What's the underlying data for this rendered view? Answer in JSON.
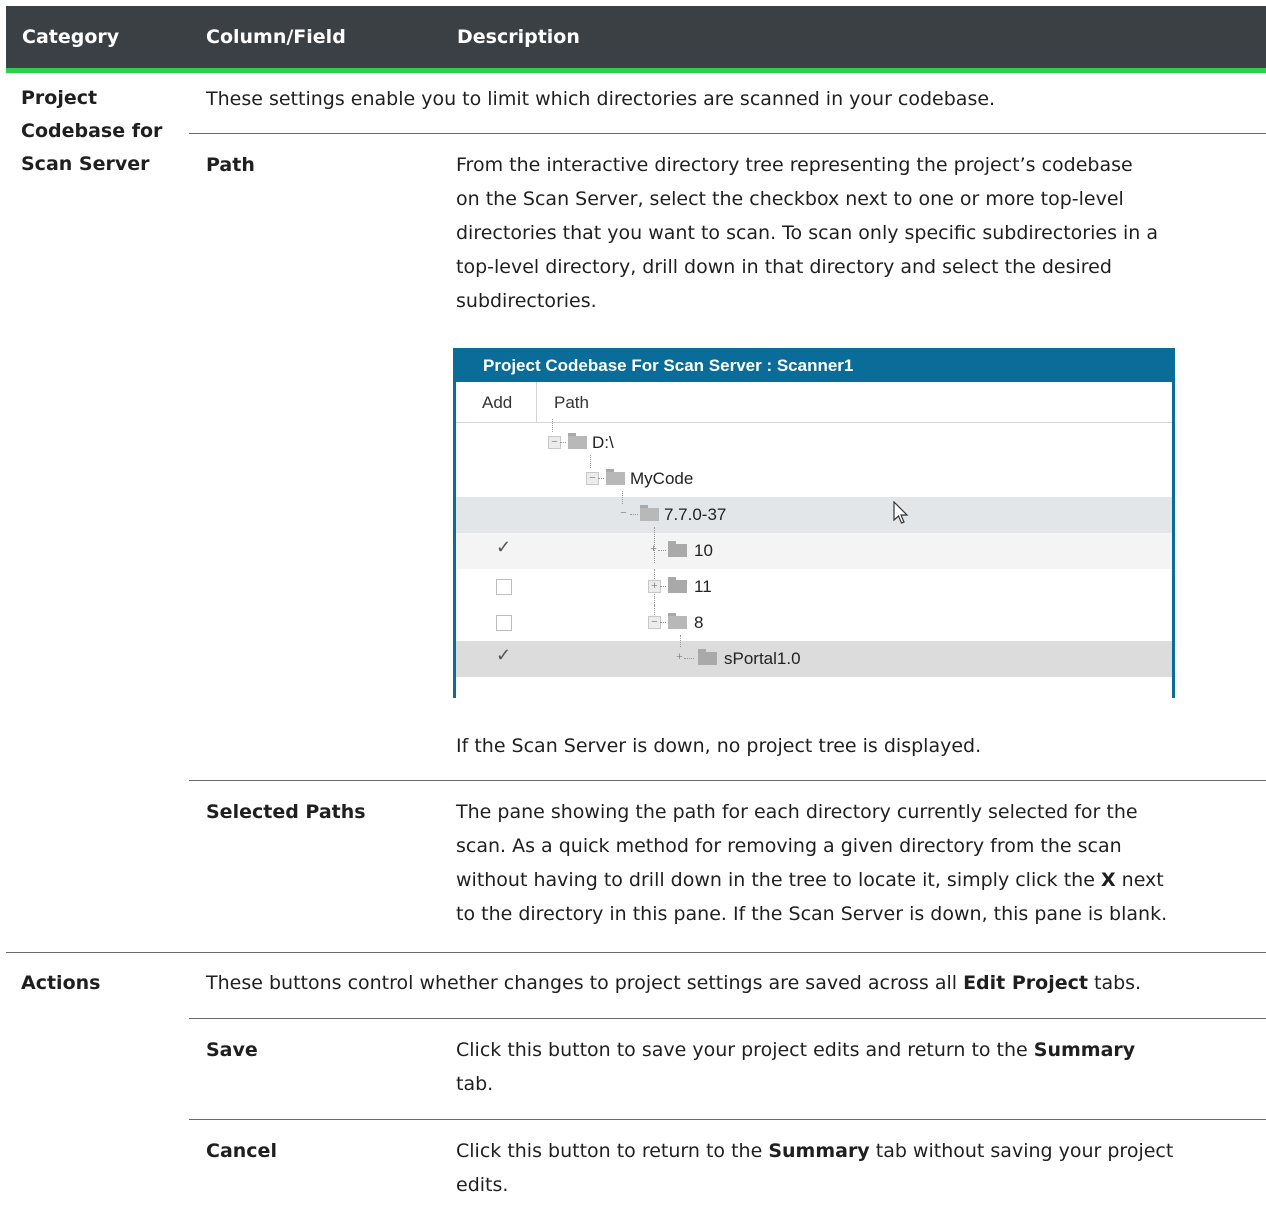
{
  "header": {
    "col1": "Category",
    "col2": "Column/Field",
    "col3": "Description"
  },
  "section1": {
    "category": [
      "Project",
      "Codebase for",
      "Scan Server"
    ],
    "intro": "These settings enable you to limit which directories are scanned in your codebase.",
    "path_field": "Path",
    "path_desc": [
      "From the interactive directory tree representing the project’s codebase",
      "on the Scan Server, select the checkbox next to one or more top-level",
      "directories that you want to scan. To scan only specific subdirectories in a",
      "top-level directory, drill down in that directory and select the desired",
      "subdirectories."
    ],
    "path_note": "If the Scan Server is down, no project tree is displayed.",
    "selected_field": "Selected Paths",
    "selected_desc": [
      "The pane showing the path for each directory currently selected for the",
      "scan. As a quick method for removing a given directory from the scan",
      "without having to drill down in the tree to locate it, simply click the ",
      "X",
      " next",
      "to the directory in this pane. If the Scan Server is down, this pane is blank."
    ]
  },
  "screenshot": {
    "title": "Project Codebase For Scan Server : Scanner1",
    "col_add": "Add",
    "col_path": "Path",
    "rows": [
      {
        "label": "D:\\",
        "checked": null
      },
      {
        "label": "MyCode",
        "checked": null
      },
      {
        "label": "7.7.0-37",
        "checked": null
      },
      {
        "label": "10",
        "checked": true
      },
      {
        "label": "11",
        "checked": false
      },
      {
        "label": "8",
        "checked": false
      },
      {
        "label": "sPortal1.0",
        "checked": true
      }
    ]
  },
  "section2": {
    "category": "Actions",
    "intro_a": "These buttons control whether changes to project settings are saved across all ",
    "intro_b": "Edit Project",
    "intro_c": " tabs.",
    "save_field": "Save",
    "save_desc_a": "Click this button to save your project edits and return to the ",
    "save_desc_b": "Summary",
    "save_desc_c": "tab.",
    "cancel_field": "Cancel",
    "cancel_desc_a": "Click this button to return to the ",
    "cancel_desc_b": "Summary",
    "cancel_desc_c": " tab without saving your project",
    "cancel_desc_d": "edits."
  }
}
